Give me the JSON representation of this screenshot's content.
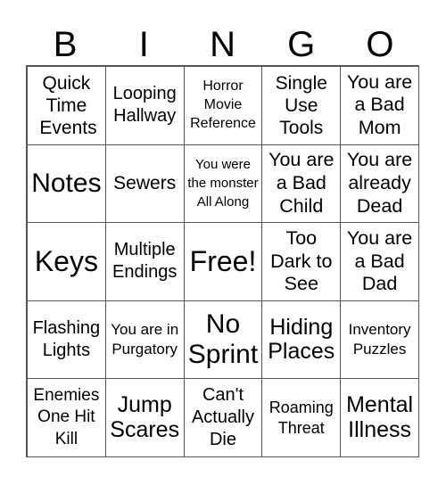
{
  "header": [
    "B",
    "I",
    "N",
    "G",
    "O"
  ],
  "cells": [
    [
      "Quick Time Events",
      "Looping Hallway",
      "Horror Movie Reference",
      "Single Use Tools",
      "You are a Bad Mom"
    ],
    [
      "Notes",
      "Sewers",
      "You were the monster All Along",
      "You are a Bad Child",
      "You are already Dead"
    ],
    [
      "Keys",
      "Multiple Endings",
      "Free!",
      "Too Dark to See",
      "You are a Bad Dad"
    ],
    [
      "Flashing Lights",
      "You are in Purgatory",
      "No Sprint",
      "Hiding Places",
      "Inventory Puzzles"
    ],
    [
      "Enemies One Hit Kill",
      "Jump Scares",
      "Can't Actually Die",
      "Roaming Threat",
      "Mental Illness"
    ]
  ]
}
